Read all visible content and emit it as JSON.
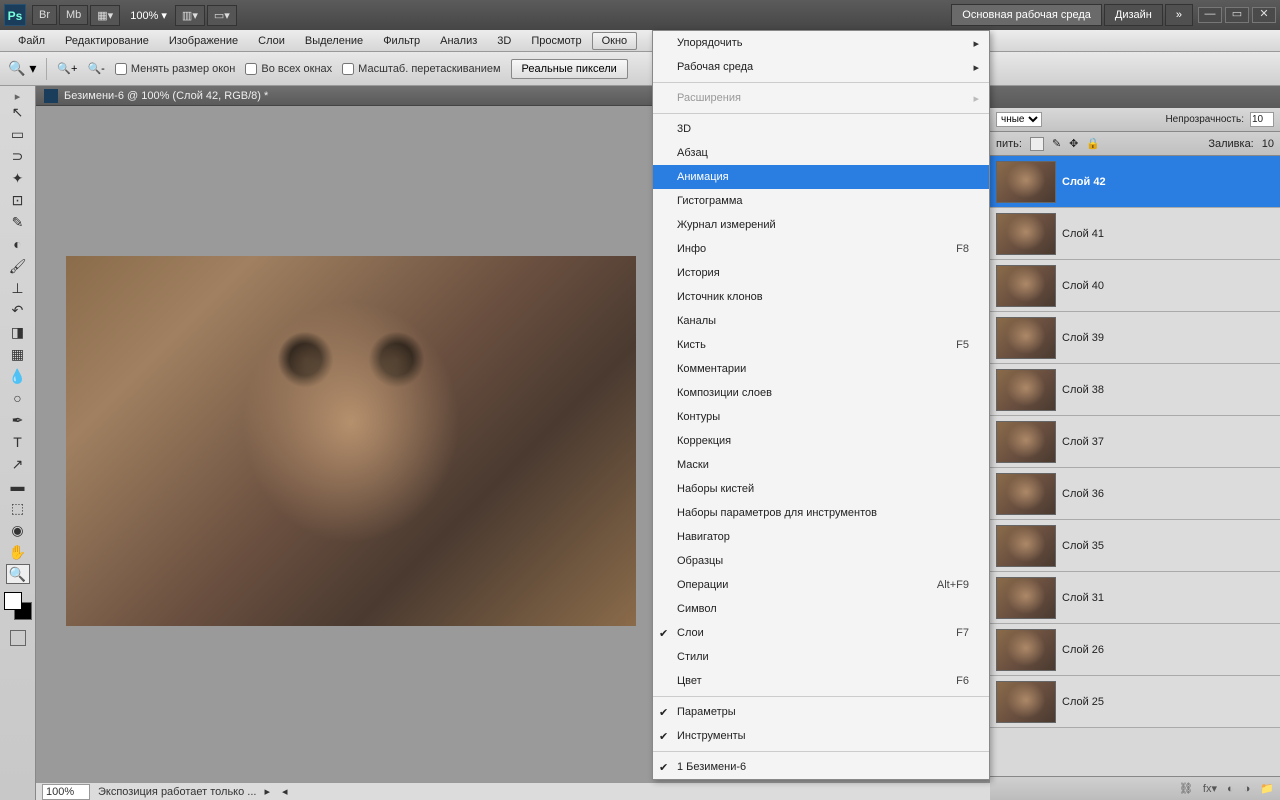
{
  "topbar": {
    "app_logo": "Ps",
    "btn_br": "Br",
    "btn_mb": "Mb",
    "zoom": "100%",
    "workspace_main": "Основная рабочая среда",
    "workspace_design": "Дизайн",
    "more": "»"
  },
  "menubar": {
    "items": [
      "Файл",
      "Редактирование",
      "Изображение",
      "Слои",
      "Выделение",
      "Фильтр",
      "Анализ",
      "3D",
      "Просмотр",
      "Окно"
    ]
  },
  "optbar": {
    "chk_resize": "Менять размер окон",
    "chk_allwin": "Во всех окнах",
    "chk_scrub": "Масштаб. перетаскиванием",
    "btn_realpx": "Реальные пиксели"
  },
  "doc": {
    "title": "Безимени-6 @ 100% (Слой 42, RGB/8) *",
    "zoom": "100%",
    "status": "Экспозиция работает только ..."
  },
  "dropdown": {
    "arrange": "Упорядочить",
    "workspace": "Рабочая среда",
    "extensions": "Расширения",
    "threed": "3D",
    "paragraph": "Абзац",
    "animation": "Анимация",
    "histogram": "Гистограмма",
    "measure": "Журнал измерений",
    "info": "Инфо",
    "info_key": "F8",
    "history": "История",
    "clone": "Источник клонов",
    "channels": "Каналы",
    "brush": "Кисть",
    "brush_key": "F5",
    "comments": "Комментарии",
    "comps": "Композиции слоев",
    "paths": "Контуры",
    "adjust": "Коррекция",
    "masks": "Маски",
    "brushsets": "Наборы кистей",
    "toolpresets": "Наборы параметров для инструментов",
    "navigator": "Навигатор",
    "swatches": "Образцы",
    "actions": "Операции",
    "actions_key": "Alt+F9",
    "character": "Символ",
    "layers": "Слои",
    "layers_key": "F7",
    "styles": "Стили",
    "color": "Цвет",
    "color_key": "F6",
    "options": "Параметры",
    "tools": "Инструменты",
    "doc1": "1 Безимени-6"
  },
  "layerpanel": {
    "mode": "чные",
    "opacity_lbl": "Непрозрачность:",
    "opacity_val": "10",
    "lock_lbl": "пить:",
    "fill_lbl": "Заливка:",
    "fill_val": "10",
    "layers": [
      {
        "name": "Слой 42",
        "sel": true
      },
      {
        "name": "Слой 41"
      },
      {
        "name": "Слой 40"
      },
      {
        "name": "Слой 39"
      },
      {
        "name": "Слой 38"
      },
      {
        "name": "Слой 37"
      },
      {
        "name": "Слой 36"
      },
      {
        "name": "Слой 35"
      },
      {
        "name": "Слой 31"
      },
      {
        "name": "Слой 26"
      },
      {
        "name": "Слой 25"
      }
    ]
  }
}
